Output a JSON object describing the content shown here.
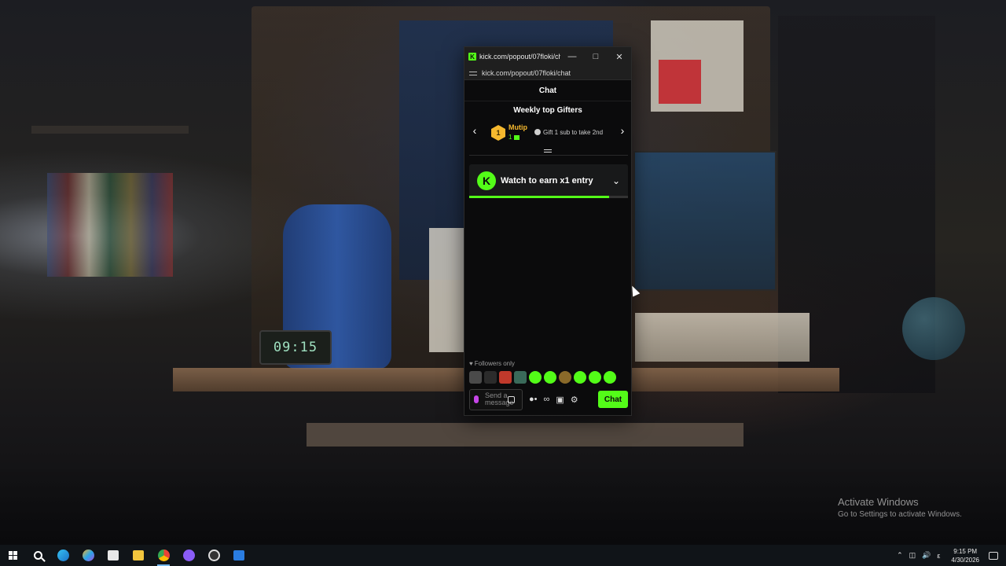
{
  "desktop": {
    "clock_prop": "09:15",
    "activate": {
      "title": "Activate Windows",
      "subtitle": "Go to Settings to activate Windows."
    }
  },
  "popup": {
    "window_title": "kick.com/popout/07floki/ch...",
    "url": "kick.com/popout/07floki/chat",
    "header": "Chat",
    "gifters": {
      "title": "Weekly top Gifters",
      "rank": "1",
      "name": "Mutip",
      "count": "1",
      "hint": "Gift 1 sub to take 2nd"
    },
    "watch": {
      "label": "Watch to earn x1 entry",
      "progress": 0.88
    },
    "followers_only": "Followers only",
    "emotes": [
      "emote-1",
      "emote-2",
      "emote-3",
      "emote-4",
      "emote-5",
      "emote-6",
      "emote-7",
      "emote-8",
      "emote-9",
      "emote-10"
    ],
    "input_placeholder": "Send a message",
    "send_label": "Chat"
  },
  "taskbar": {
    "time": "9:15 PM",
    "date": "4/30/2026",
    "apps": [
      "search",
      "edge",
      "copilot",
      "store",
      "file-explorer",
      "chrome",
      "discord",
      "obs",
      "app"
    ]
  },
  "colors": {
    "kick_green": "#53fc18",
    "gift_gold": "#f5b82e"
  }
}
